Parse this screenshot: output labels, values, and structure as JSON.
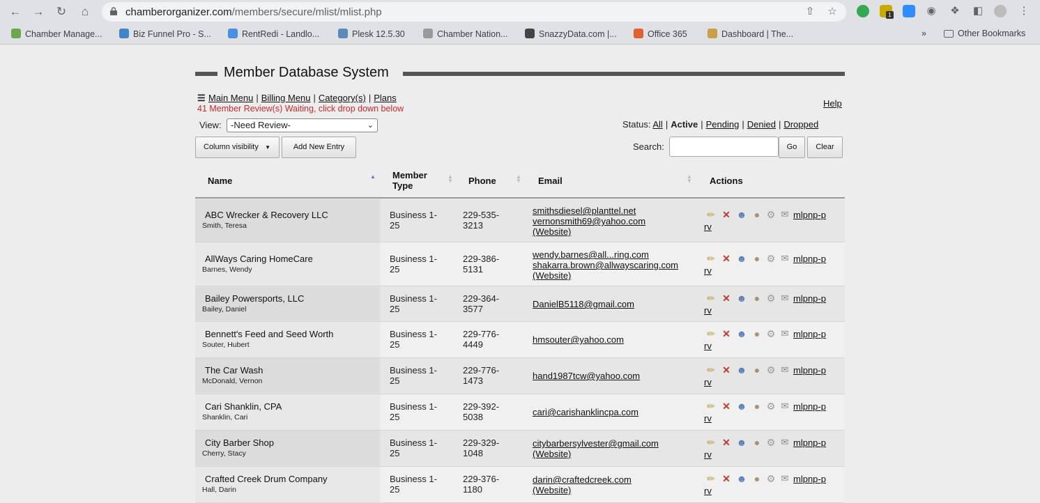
{
  "browser": {
    "url_host": "chamberorganizer.com",
    "url_path": "/members/secure/mlist/mlist.php",
    "bookmarks": [
      {
        "label": "Chamber Manage...",
        "color": "#6aa84f"
      },
      {
        "label": "Biz Funnel Pro - S...",
        "color": "#3d85c6"
      },
      {
        "label": "RentRedi - Landlo...",
        "color": "#4a90e2"
      },
      {
        "label": "Plesk 12.5.30",
        "color": "#5b8ab8"
      },
      {
        "label": "Chamber Nation...",
        "color": "#999999"
      },
      {
        "label": "SnazzyData.com |...",
        "color": "#444444"
      },
      {
        "label": "Office 365",
        "color": "#e06030"
      },
      {
        "label": "Dashboard | The...",
        "color": "#c9a04a"
      }
    ],
    "other_bookmarks": "Other Bookmarks",
    "overflow": "»",
    "badge": "1"
  },
  "page": {
    "title": "Member Database System",
    "menu": [
      "Main Menu",
      "Billing Menu",
      "Category(s)",
      "Plans"
    ],
    "review_note": "41 Member Review(s) Waiting, click drop down below",
    "help": "Help",
    "view_label": "View:",
    "view_value": "-Need Review-",
    "status_label": "Status:",
    "status_all": "All",
    "status_active": "Active",
    "status_pending": "Pending",
    "status_denied": "Denied",
    "status_dropped": "Dropped",
    "col_visibility": "Column visibility",
    "add_entry": "Add New Entry",
    "search_label": "Search:",
    "go": "Go",
    "clear": "Clear"
  },
  "table": {
    "headers": {
      "name": "Name",
      "member_type": "Member Type",
      "phone": "Phone",
      "email": "Email",
      "actions": "Actions"
    },
    "rows": [
      {
        "biz": "ABC Wrecker & Recovery LLC",
        "contact": "Smith, Teresa",
        "type_1": "Business 1-",
        "type_2": "25",
        "phone_1": "229-535-",
        "phone_2": "3213",
        "emails": [
          "smithsdiesel@planttel.net",
          "vernonsmith69@yahoo.com"
        ],
        "website": "(Website)",
        "link_1": "mlpnp-p",
        "link_2": "rv"
      },
      {
        "biz": "AllWays Caring HomeCare",
        "contact": "Barnes, Wendy",
        "type_1": "Business 1-",
        "type_2": "25",
        "phone_1": "229-386-",
        "phone_2": "5131",
        "emails": [
          "wendy.barnes@all...ring.com",
          "shakarra.brown@allwayscaring.com"
        ],
        "website": "(Website)",
        "link_1": "mlpnp-p",
        "link_2": "rv"
      },
      {
        "biz": "Bailey Powersports, LLC",
        "contact": "Bailey, Daniel",
        "type_1": "Business 1-",
        "type_2": "25",
        "phone_1": "229-364-",
        "phone_2": "3577",
        "emails": [
          "DanielB5118@gmail.com"
        ],
        "website": "",
        "link_1": "mlpnp-p",
        "link_2": "rv"
      },
      {
        "biz": "Bennett's Feed and Seed Worth",
        "contact": "Souter, Hubert",
        "type_1": "Business 1-",
        "type_2": "25",
        "phone_1": "229-776-",
        "phone_2": "4449",
        "emails": [
          "hmsouter@yahoo.com"
        ],
        "website": "",
        "link_1": "mlpnp-p",
        "link_2": "rv"
      },
      {
        "biz": "The Car Wash",
        "contact": "McDonald, Vernon",
        "type_1": "Business 1-",
        "type_2": "25",
        "phone_1": "229-776-",
        "phone_2": "1473",
        "emails": [
          "hand1987tcw@yahoo.com"
        ],
        "website": "",
        "link_1": "mlpnp-p",
        "link_2": "rv"
      },
      {
        "biz": "Cari Shanklin, CPA",
        "contact": "Shanklin, Cari",
        "type_1": "Business 1-",
        "type_2": "25",
        "phone_1": "229-392-",
        "phone_2": "5038",
        "emails": [
          "cari@carishanklincpa.com"
        ],
        "website": "",
        "link_1": "mlpnp-p",
        "link_2": "rv"
      },
      {
        "biz": "City Barber Shop",
        "contact": "Cherry, Stacy",
        "type_1": "Business 1-",
        "type_2": "25",
        "phone_1": "229-329-",
        "phone_2": "1048",
        "emails": [
          "citybarbersylvester@gmail.com"
        ],
        "website": "(Website)",
        "link_1": "mlpnp-p",
        "link_2": "rv"
      },
      {
        "biz": "Crafted Creek Drum Company",
        "contact": "Hall, Darin",
        "type_1": "Business 1-",
        "type_2": "25",
        "phone_1": "229-376-",
        "phone_2": "1180",
        "emails": [
          "darin@craftedcreek.com"
        ],
        "website": "(Website)",
        "link_1": "mlpnp-p",
        "link_2": "rv"
      }
    ]
  }
}
